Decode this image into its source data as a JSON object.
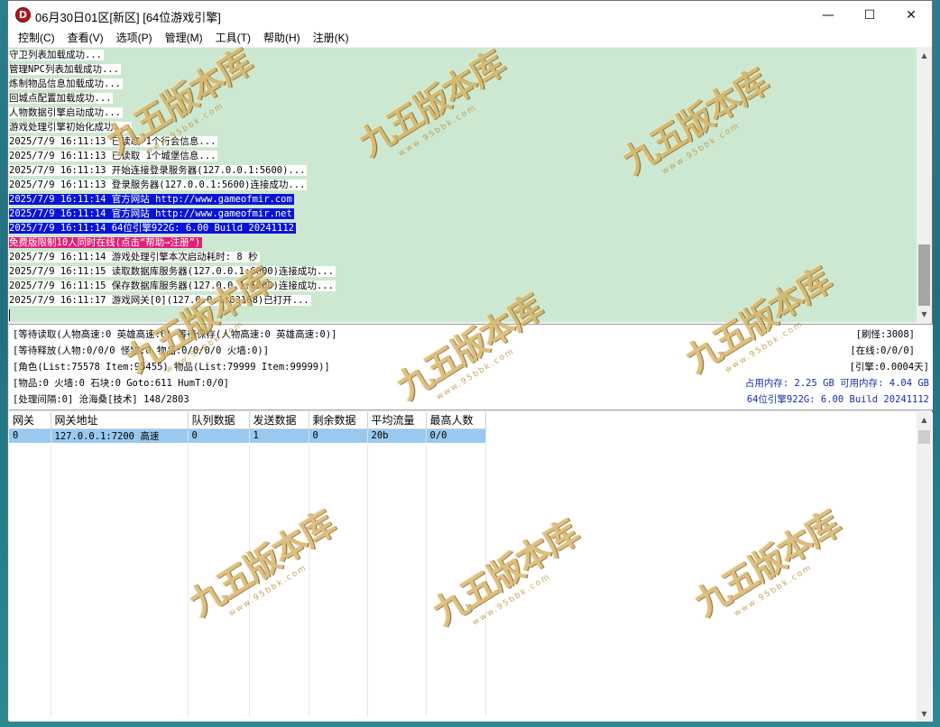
{
  "window": {
    "title": "06月30日01区[新区] [64位游戏引擎]",
    "icon_letter": "D",
    "minimize": "—",
    "maximize": "☐",
    "close": "✕"
  },
  "menu": [
    "控制(C)",
    "查看(V)",
    "选项(P)",
    "管理(M)",
    "工具(T)",
    "帮助(H)",
    "注册(K)"
  ],
  "log": [
    {
      "text": "守卫列表加载成功...",
      "style": "white"
    },
    {
      "text": "管理NPC列表加载成功...",
      "style": "white"
    },
    {
      "text": "炼制物品信息加载成功...",
      "style": "white"
    },
    {
      "text": "回城点配置加载成功...",
      "style": "white"
    },
    {
      "text": "人物数据引擎启动成功...",
      "style": "white"
    },
    {
      "text": "游戏处理引擎初始化成功...",
      "style": "white"
    },
    {
      "text": "2025/7/9 16:11:13 已读取 1个行会信息...",
      "style": "white"
    },
    {
      "text": "2025/7/9 16:11:13 已读取 1个城堡信息...",
      "style": "white"
    },
    {
      "text": "2025/7/9 16:11:13 开始连接登录服务器(127.0.0.1:5600)...",
      "style": "white"
    },
    {
      "text": "2025/7/9 16:11:13 登录服务器(127.0.0.1:5600)连接成功...",
      "style": "white"
    },
    {
      "text": "2025/7/9 16:11:14 官方网站 http://www.gameofmir.com",
      "style": "blue"
    },
    {
      "text": "2025/7/9 16:11:14 官方网站 http://www.gameofmir.net",
      "style": "blue"
    },
    {
      "text": "2025/7/9 16:11:14 64位引擎922G: 6.00 Build 20241112",
      "style": "blue"
    },
    {
      "text": "免费版限制10人同时在线(点击“帮助→注册”)",
      "style": "pink"
    },
    {
      "text": "2025/7/9 16:11:14 游戏处理引擎本次启动耗时: 8 秒",
      "style": "white"
    },
    {
      "text": "2025/7/9 16:11:15 读取数据库服务器(127.0.0.1:6000)连接成功...",
      "style": "white"
    },
    {
      "text": "2025/7/9 16:11:15 保存数据库服务器(127.0.0.1:6000)连接成功...",
      "style": "white"
    },
    {
      "text": "2025/7/9 16:11:17 游戏网关[0](127.0.0.1:63168)已打开...",
      "style": "white"
    }
  ],
  "status": {
    "line1": "[等待读取(人物高速:0 英雄高速:0) 等待保存(人物高速:0 英雄高速:0)]",
    "line2": "[等待释放(人物:0/0/0 怪物:0 物品:0/0/0/0 火墙:0)]",
    "line3": "[角色(List:75578 Item:95455) 物品(List:79999 Item:99999)]",
    "line4": "[物品:0 火墙:0 石块:0 Goto:611 HumT:0/0]",
    "line5": "[处理间隔:0]   沧海桑[技术] 148/2803",
    "refresh": "[刷怪:3008]",
    "online": "[在线:0/0/0]",
    "engine": "[引擎:0.0004天]",
    "memory": "占用内存: 2.25 GB 可用内存: 4.04 GB",
    "build": "64位引擎922G: 6.00 Build 20241112"
  },
  "gateway_table": {
    "headers": [
      "网关",
      "网关地址",
      "队列数据",
      "发送数据",
      "剩余数据",
      "平均流量",
      "最高人数"
    ],
    "rows": [
      [
        "0",
        "127.0.0.1:7200 高速",
        "0",
        "1",
        "0",
        "20b",
        "0/0"
      ]
    ]
  },
  "watermark": {
    "text": "九五版本库",
    "url": "www.95bbk.com"
  }
}
